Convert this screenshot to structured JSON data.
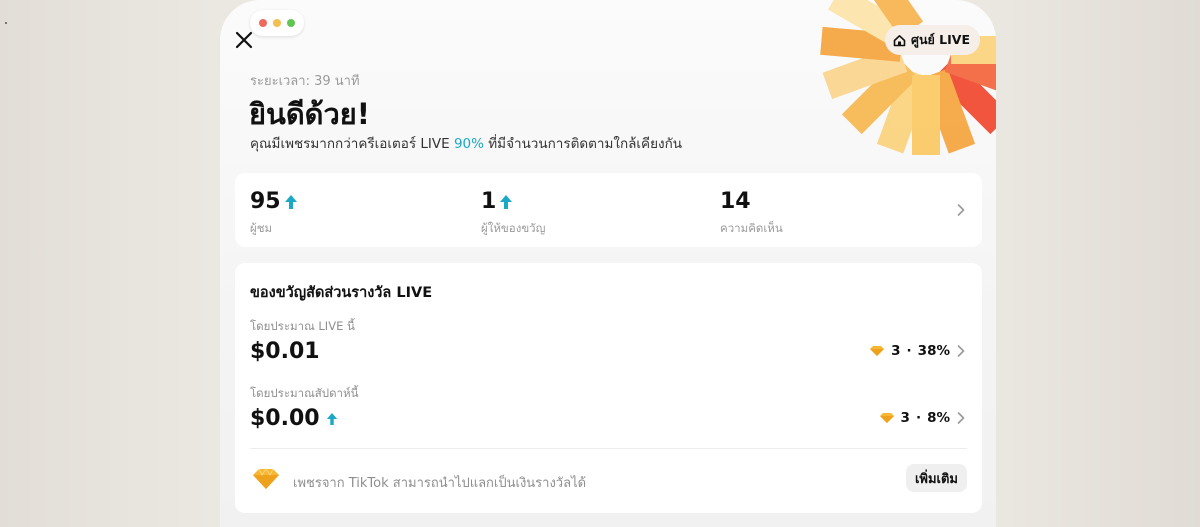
{
  "panel": {
    "center_button": "ศูนย์ LIVE",
    "duration": "ระยะเวลา: 39 นาที",
    "title": "ยินดีด้วย!",
    "subtitle_prefix": "คุณมีเพชรมากกว่าครีเอเตอร์ LIVE ",
    "subtitle_percent": "90%",
    "subtitle_suffix": " ที่มีจำนวนการติดตามใกล้เคียงกัน"
  },
  "stats": [
    {
      "value": "95",
      "label": "ผู้ชม",
      "trend": "up"
    },
    {
      "value": "1",
      "label": "ผู้ให้ของขวัญ",
      "trend": "up"
    },
    {
      "value": "14",
      "label": "ความคิดเห็น",
      "trend": "none"
    }
  ],
  "rewards": {
    "title": "ของขวัญสัดส่วนรางวัล LIVE",
    "this_live": {
      "label": "โดยประมาณ LIVE นี้",
      "amount": "$0.01",
      "diamonds": "3",
      "separator": "·",
      "percent": "38%"
    },
    "this_week": {
      "label": "โดยประมาณสัปดาห์นี้",
      "amount": "$0.00",
      "diamonds": "3",
      "separator": "·",
      "percent": "8%"
    },
    "footer_text": "เพชรจาก TikTok สามารถนำไปแลกเป็นเงินรางวัลได้",
    "more_button": "เพิ่มเติม"
  },
  "colors": {
    "accent": "#1ba8c4",
    "diamond": "#f6b733",
    "burst_orange": "#f5a23a",
    "burst_red": "#f0432a"
  },
  "icons": [
    "close-icon",
    "home-icon",
    "up-arrow-icon",
    "chevron-right-icon",
    "diamond-icon"
  ]
}
